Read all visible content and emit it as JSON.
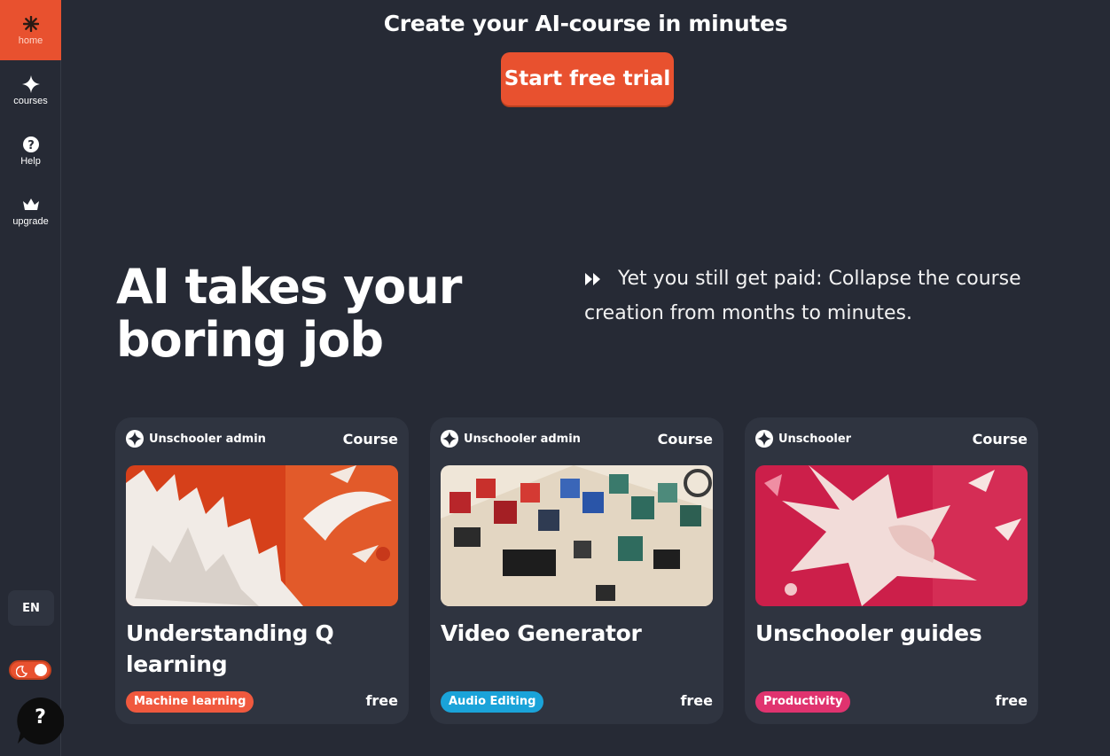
{
  "sidebar": {
    "items": [
      {
        "label": "home",
        "icon": "asterisk-icon"
      },
      {
        "label": "courses",
        "icon": "sparkle-icon"
      },
      {
        "label": "Help",
        "icon": "question-circle-icon"
      },
      {
        "label": "upgrade",
        "icon": "crown-icon"
      }
    ],
    "language": "EN",
    "help_bubble": "?"
  },
  "banner": {
    "title": "Create your AI-course in minutes",
    "cta_label": "Start free trial"
  },
  "hero": {
    "title": "AI takes your boring job",
    "subtitle": "Yet you still get paid: Collapse the course creation from months to minutes."
  },
  "cards": [
    {
      "author": "Unschooler admin",
      "kind": "Course",
      "title": "Understanding Q learning",
      "tag": "Machine learning",
      "tag_color": "#f0593e",
      "price": "free"
    },
    {
      "author": "Unschooler admin",
      "kind": "Course",
      "title": "Video Generator",
      "tag": "Audio Editing",
      "tag_color": "#1aa3d9",
      "price": "free"
    },
    {
      "author": "Unschooler",
      "kind": "Course",
      "title": "Unschooler guides",
      "tag": "Productivity",
      "tag_color": "#e0336f",
      "price": "free"
    }
  ],
  "colors": {
    "background": "#262a35",
    "card": "#2f3440",
    "accent": "#e8512f"
  }
}
